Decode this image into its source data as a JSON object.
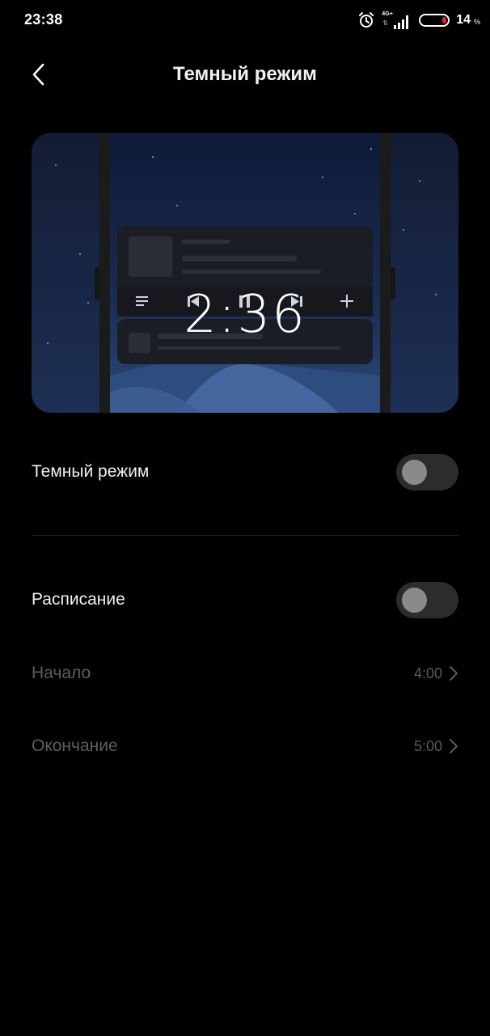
{
  "status_bar": {
    "time": "23:38",
    "network_type": "4G+",
    "battery_level": "14",
    "battery_unit": "%",
    "icons": [
      "alarm-icon",
      "signal-icon",
      "battery-icon"
    ]
  },
  "header": {
    "title": "Темный режим",
    "back_icon": "back-chevron-icon"
  },
  "preview": {
    "clock": "2:36",
    "media_controls": [
      "list-icon",
      "previous-icon",
      "pause-icon",
      "next-icon",
      "plus-icon"
    ]
  },
  "settings": {
    "dark_mode": {
      "label": "Темный режим",
      "enabled": false
    },
    "schedule": {
      "label": "Расписание",
      "enabled": false
    },
    "start": {
      "label": "Начало",
      "value": "4:00"
    },
    "end": {
      "label": "Окончание",
      "value": "5:00"
    }
  },
  "colors": {
    "background": "#000000",
    "toggle_track": "#2c2c2c",
    "toggle_knob": "#8a8a8a",
    "dim_text": "#5e5e5e",
    "preview_sky": "#1a2a4e"
  }
}
